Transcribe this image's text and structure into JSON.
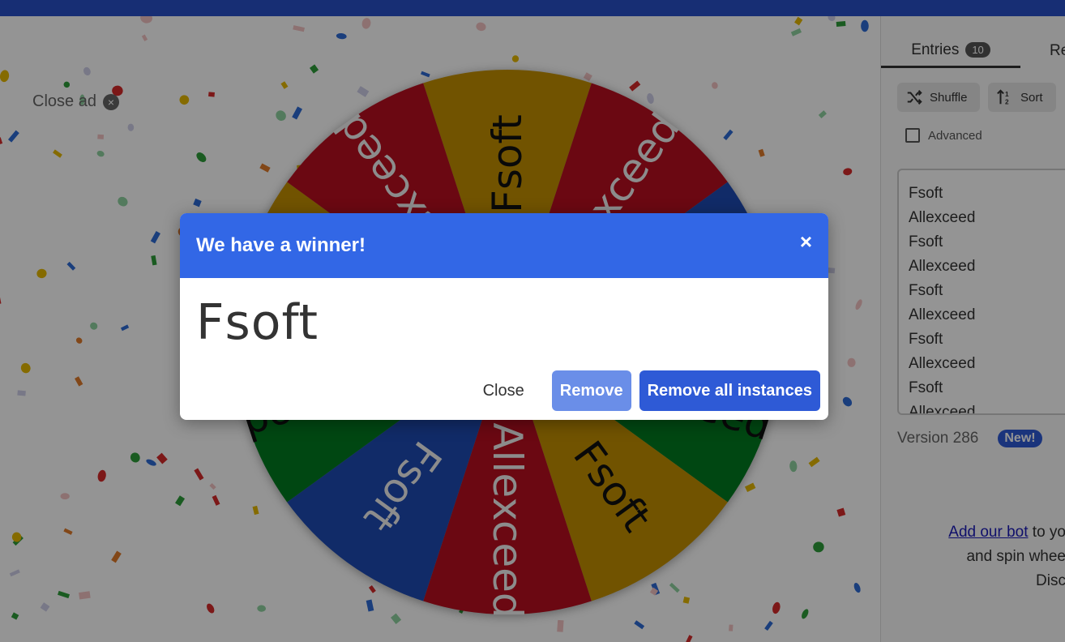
{
  "ad": {
    "close_label": "Close ad"
  },
  "wheel": {
    "slices": [
      {
        "label": "Fsoft",
        "color": "#c39000"
      },
      {
        "label": "Allexceed",
        "color": "#b80f1f"
      },
      {
        "label": "Fsoft",
        "color": "#1e4bb4"
      },
      {
        "label": "Allexceed",
        "color": "#007a1f"
      },
      {
        "label": "Fsoft",
        "color": "#c39000"
      },
      {
        "label": "Allexceed",
        "color": "#b80f1f"
      },
      {
        "label": "Fsoft",
        "color": "#1e4bb4"
      },
      {
        "label": "Allexceed",
        "color": "#007a1f"
      },
      {
        "label": "Fsoft",
        "color": "#c39000"
      },
      {
        "label": "Allexceed",
        "color": "#b80f1f"
      }
    ]
  },
  "sidebar": {
    "tab_entries": "Entries",
    "entries_count": "10",
    "tab_results": "Re",
    "shuffle_label": "Shuffle",
    "sort_label": "Sort",
    "advanced_label": "Advanced",
    "entries": [
      "Fsoft",
      "Allexceed",
      "Fsoft",
      "Allexceed",
      "Fsoft",
      "Allexceed",
      "Fsoft",
      "Allexceed",
      "Fsoft",
      "Allexceed"
    ],
    "version_label": "Version 286",
    "new_badge": "New!",
    "bot_link": "Add our bot",
    "bot_line1_rest": " to yo",
    "bot_line2": "and spin whee",
    "bot_line3": "Disc"
  },
  "modal": {
    "title": "We have a winner!",
    "close_icon": "×",
    "winner": "Fsoft",
    "close_label": "Close",
    "remove_label": "Remove",
    "remove_all_label": "Remove all instances"
  }
}
